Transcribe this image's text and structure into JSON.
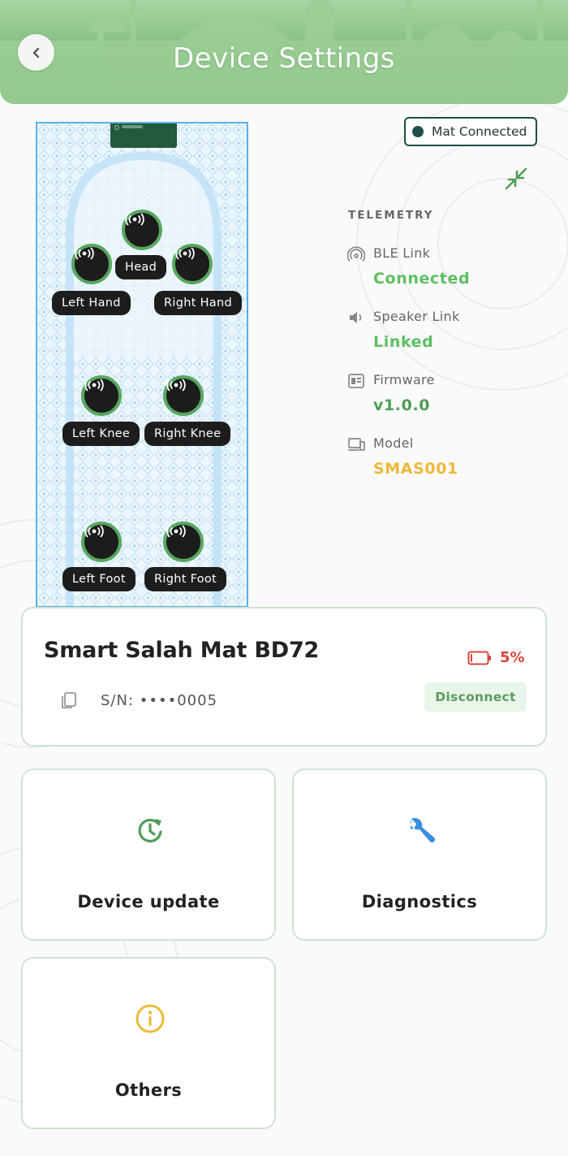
{
  "header": {
    "title": "Device Settings",
    "back_icon": "chevron-left-icon"
  },
  "mat": {
    "status_label": "Mat Connected",
    "sensors": [
      {
        "id": "head",
        "label": "Head"
      },
      {
        "id": "left-hand",
        "label": "Left Hand"
      },
      {
        "id": "right-hand",
        "label": "Right Hand"
      },
      {
        "id": "left-knee",
        "label": "Left Knee"
      },
      {
        "id": "right-knee",
        "label": "Right Knee"
      },
      {
        "id": "left-foot",
        "label": "Left Foot"
      },
      {
        "id": "right-foot",
        "label": "Right Foot"
      }
    ]
  },
  "telemetry": {
    "heading": "TELEMETRY",
    "ble": {
      "label": "BLE Link",
      "value": "Connected",
      "color": "#5cbf63"
    },
    "speaker": {
      "label": "Speaker Link",
      "value": "Linked",
      "color": "#5cbf63"
    },
    "firmware": {
      "label": "Firmware",
      "value": "v1.0.0",
      "color": "#4f9d55"
    },
    "model": {
      "label": "Model",
      "value": "SMAS001",
      "color": "#edb93a"
    }
  },
  "device": {
    "name": "Smart Salah Mat BD72",
    "battery_percent": "5%",
    "battery_level": 0.05,
    "serial": "S/N: ••••0005",
    "disconnect_label": "Disconnect"
  },
  "actions": {
    "device_update": "Device update",
    "diagnostics": "Diagnostics",
    "others": "Others"
  },
  "colors": {
    "header_green": "#7fba7a",
    "accent_green": "#5cbf63",
    "danger_red": "#d9453b",
    "model_yellow": "#edb93a",
    "diagnostics_blue": "#3a8de0"
  }
}
